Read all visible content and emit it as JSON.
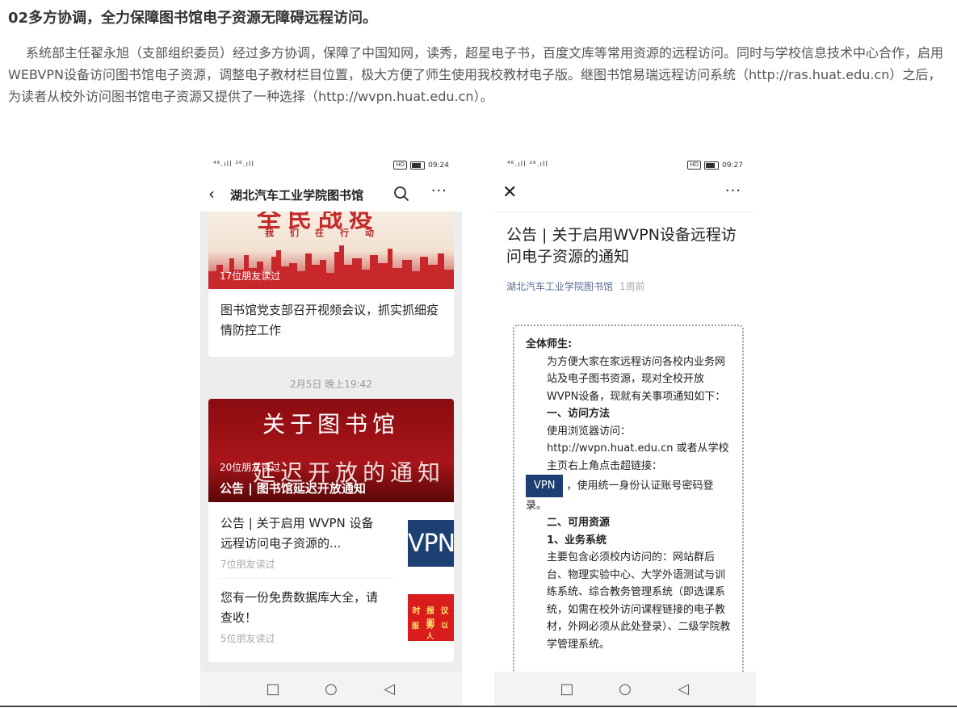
{
  "heading": "02多方协调，全力保障图书馆电子资源无障碍远程访问。",
  "paragraph": "系统部主任翟永旭（支部组织委员）经过多方协调，保障了中国知网，读秀，超星电子书，百度文库等常用资源的远程访问。同时与学校信息技术中心合作，启用WEBVPN设备访问图书馆电子资源，调整电子教材栏目位置，极大方便了师生使用我校教材电子版。继图书馆易瑞远程访问系统（http://ras.huat.edu.cn）之后，为读者从校外访问图书馆电子资源又提供了一种选择（http://wvpn.huat.edu.cn）。",
  "left_phone": {
    "status": {
      "signal": "⁴⁶.ıll ²⁶.ıll",
      "hd": "HD",
      "time": "09:24"
    },
    "nav": {
      "back": "‹",
      "title": "湖北汽车工业学院图书馆",
      "more": "···"
    },
    "card1": {
      "banner_big": "全民战疫",
      "banner_small": "我们在行动",
      "readers": "17位朋友读过",
      "text": "图书馆党支部召开视频会议，抓实抓细疫情防控工作"
    },
    "date": "2月5日 晚上19:42",
    "card2": {
      "banner_line1": "关于图书馆",
      "banner_line2": "延迟开放的通知",
      "readers": "20位朋友读过",
      "caption": "公告 | 图书馆延迟开放通知",
      "item1_text": "公告 | 关于启用 WVPN 设备远程访问电子资源的...",
      "item1_readers": "7位朋友读过",
      "item1_thumb": "VPN",
      "item2_text": "您有一份免费数据库大全，请查收！",
      "item2_readers": "5位朋友读过",
      "item2_thumb_r1": "时 报 议 图",
      "item2_thumb_r2": "服 务 以 人"
    },
    "android_nav": {
      "square": "□",
      "circle": "○",
      "back": "◁"
    }
  },
  "right_phone": {
    "status": {
      "signal": "⁴⁶.ıll ²⁶.ıll",
      "hd": "HD",
      "time": "09:27"
    },
    "nav": {
      "close": "✕",
      "more": "···"
    },
    "title": "公告 | 关于启用WVPN设备远程访问电子资源的通知",
    "account": "湖北汽车工业学院图书馆",
    "ago": "1周前",
    "notice": {
      "greeting": "全体师生:",
      "p1": "为方便大家在家远程访问各校内业务网站及电子图书资源，现对全校开放WVPN设备，现就有关事项通知如下：",
      "s1": "一、访问方法",
      "s1a": "使用浏览器访问：",
      "url_line": "http://wvpn.huat.edu.cn 或者从学校主页右上角点击超链接：",
      "vpn_button": "VPN",
      "after_button": "，使用统一身份认证账号密码登录。",
      "s2": "二、可用资源",
      "s2a": "1、业务系统",
      "p2": "主要包含必须校内访问的：网站群后台、物理实验中心、大学外语测试与训练系统、综合教务管理系统（即选课系统，如需在校外访问课程链接的电子教材，外网必须从此处登录）、二级学院教学管理系统。"
    },
    "android_nav": {
      "square": "□",
      "circle": "○",
      "back": "◁"
    }
  }
}
